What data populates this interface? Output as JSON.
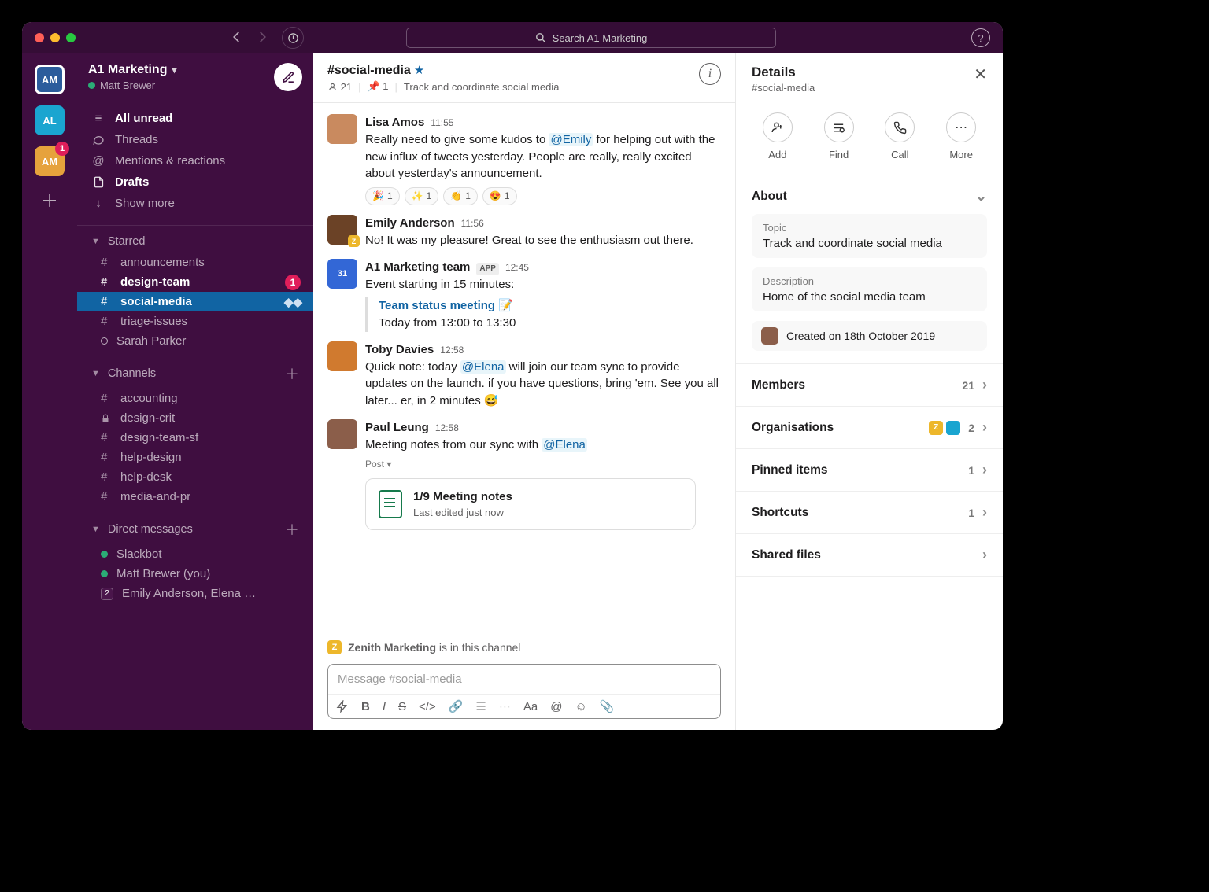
{
  "titlebar": {
    "search_placeholder": "Search A1 Marketing"
  },
  "rail": {
    "ws1": "AM",
    "ws2": "AL",
    "ws3": "AM",
    "ws3_badge": "1"
  },
  "sidebar": {
    "workspace": "A1 Marketing",
    "user": "Matt Brewer",
    "nav": {
      "all_unread": "All unread",
      "threads": "Threads",
      "mentions": "Mentions & reactions",
      "drafts": "Drafts",
      "show_more": "Show more"
    },
    "starred_label": "Starred",
    "starred": [
      {
        "name": "announcements",
        "type": "#",
        "bold": false
      },
      {
        "name": "design-team",
        "type": "#",
        "bold": true,
        "badge": "1"
      },
      {
        "name": "social-media",
        "type": "#",
        "bold": true,
        "active": true
      },
      {
        "name": "triage-issues",
        "type": "#",
        "bold": false
      },
      {
        "name": "Sarah Parker",
        "type": "dm",
        "bold": false
      }
    ],
    "channels_label": "Channels",
    "channels": [
      {
        "name": "accounting",
        "type": "#"
      },
      {
        "name": "design-crit",
        "type": "lock"
      },
      {
        "name": "design-team-sf",
        "type": "#"
      },
      {
        "name": "help-design",
        "type": "#"
      },
      {
        "name": "help-desk",
        "type": "#"
      },
      {
        "name": "media-and-pr",
        "type": "#"
      }
    ],
    "dms_label": "Direct messages",
    "dms": [
      {
        "name": "Slackbot",
        "pres": "active"
      },
      {
        "name": "Matt Brewer (you)",
        "pres": "active"
      },
      {
        "name": "Emily Anderson, Elena …",
        "pres": "multi",
        "count": "2"
      }
    ]
  },
  "channel": {
    "name": "#social-media",
    "members": "21",
    "pins": "1",
    "topic": "Track and coordinate social media"
  },
  "messages": [
    {
      "user": "Lisa Amos",
      "time": "11:55",
      "av": "av-lisa",
      "text_pre": "Really need to give some kudos to ",
      "mention": "@Emily",
      "text_post": " for helping out with the new influx of tweets yesterday. People are really, really excited about yesterday's announcement.",
      "reacts": [
        {
          "e": "🎉",
          "n": "1"
        },
        {
          "e": "✨",
          "n": "1"
        },
        {
          "e": "👏",
          "n": "1"
        },
        {
          "e": "😍",
          "n": "1"
        }
      ]
    },
    {
      "user": "Emily Anderson",
      "time": "11:56",
      "av": "av-emily",
      "ext": "Z",
      "text": "No! It was my pleasure! Great to see the enthusiasm out there."
    },
    {
      "user": "A1 Marketing team",
      "time": "12:45",
      "av": "av-app",
      "app": "APP",
      "av_text": "31",
      "text": "Event starting in 15 minutes:",
      "event": {
        "title": "Team status meeting 📝",
        "when": "Today from 13:00 to 13:30"
      }
    },
    {
      "user": "Toby Davies",
      "time": "12:58",
      "av": "av-toby",
      "text_pre": "Quick note: today ",
      "mention": "@Elena",
      "text_post": " will join our team sync to provide updates on the launch. if you have questions, bring 'em. See you all later... er, in 2 minutes 😅"
    },
    {
      "user": "Paul Leung",
      "time": "12:58",
      "av": "av-paul",
      "text_pre": "Meeting notes from our sync with ",
      "mention": "@Elena",
      "post": {
        "label": "Post ▾",
        "title": "1/9 Meeting notes",
        "sub": "Last edited just now"
      }
    }
  ],
  "channel_note": {
    "org": "Zenith Marketing",
    "suffix": " is in this channel",
    "badge": "Z"
  },
  "composer": {
    "placeholder": "Message #social-media"
  },
  "details": {
    "title": "Details",
    "sub": "#social-media",
    "actions": {
      "add": "Add",
      "find": "Find",
      "call": "Call",
      "more": "More"
    },
    "about_label": "About",
    "topic_label": "Topic",
    "topic": "Track and coordinate social media",
    "desc_label": "Description",
    "desc": "Home of the social media team",
    "created": "Created on 18th October 2019",
    "rows": {
      "members": {
        "label": "Members",
        "val": "21"
      },
      "orgs": {
        "label": "Organisations",
        "val": "2",
        "badge": "Z"
      },
      "pinned": {
        "label": "Pinned items",
        "val": "1"
      },
      "shortcuts": {
        "label": "Shortcuts",
        "val": "1"
      },
      "files": {
        "label": "Shared files"
      }
    }
  }
}
